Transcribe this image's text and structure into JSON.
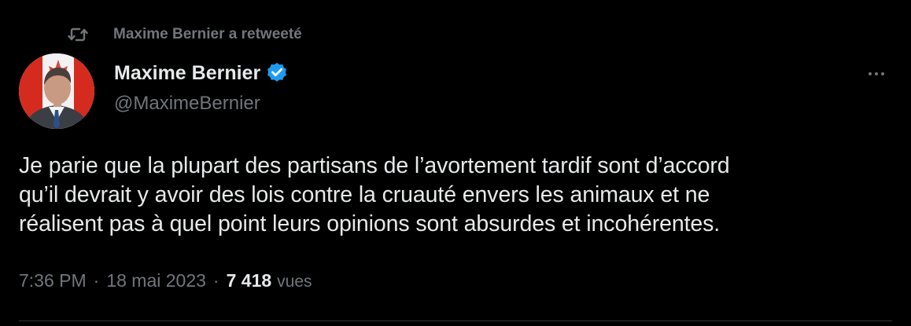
{
  "retweet": {
    "icon": "retweet-icon",
    "label": "Maxime Bernier a retweeté"
  },
  "author": {
    "avatar_icon": "avatar",
    "name": "Maxime Bernier",
    "verified_icon": "verified-badge-icon",
    "handle": "@MaximeBernier"
  },
  "menu": {
    "icon": "more-options-icon"
  },
  "tweet": {
    "lines": [
      "Je parie que la plupart des partisans de l’avortement tardif sont d’accord",
      "qu’il devrait y avoir des lois contre la cruauté envers les animaux et ne",
      "réalisent pas à quel point leurs opinions sont absurdes et incohérentes."
    ]
  },
  "meta": {
    "time": "7:36 PM",
    "separator": "·",
    "date": "18 mai 2023",
    "views_count": "7 418",
    "views_label": "vues"
  },
  "colors": {
    "background": "#000000",
    "text_primary": "#e7e9ea",
    "text_secondary": "#71767b",
    "verified_blue": "#1d9bf0",
    "divider": "#2f3336"
  }
}
